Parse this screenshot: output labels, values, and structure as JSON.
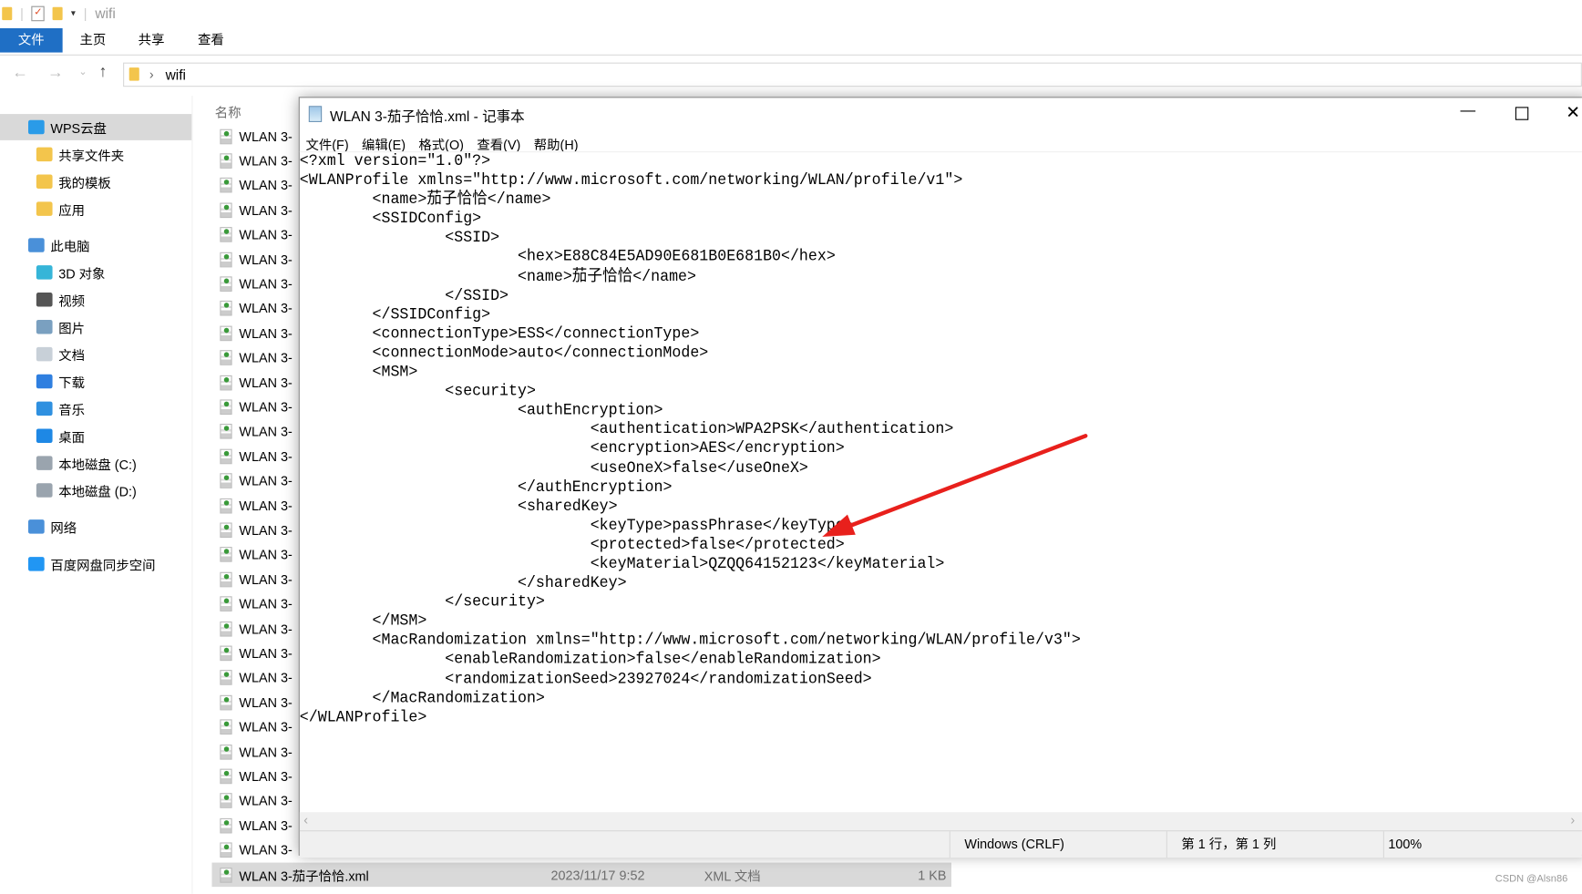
{
  "explorer": {
    "window_title": "wifi",
    "ribbon_tabs": [
      "文件",
      "主页",
      "共享",
      "查看"
    ],
    "address": {
      "path": "wifi"
    },
    "column_header_name": "名称",
    "nav_items": [
      {
        "label": "WPS云盘",
        "icon": "wps-cloud-icon",
        "color": "#2a9be8",
        "selected": true
      },
      {
        "label": "共享文件夹",
        "icon": "shared-folder-icon",
        "color": "#f3c54c"
      },
      {
        "label": "我的模板",
        "icon": "folder-icon",
        "color": "#f3c54c"
      },
      {
        "label": "应用",
        "icon": "apps-folder-icon",
        "color": "#f3c54c"
      },
      {
        "label": "此电脑",
        "icon": "computer-icon",
        "color": "#4a90d9"
      },
      {
        "label": "3D 对象",
        "icon": "3d-objects-icon",
        "color": "#36b5d8"
      },
      {
        "label": "视频",
        "icon": "video-icon",
        "color": "#555555"
      },
      {
        "label": "图片",
        "icon": "pictures-icon",
        "color": "#7aa0c0"
      },
      {
        "label": "文档",
        "icon": "documents-icon",
        "color": "#c8d0d8"
      },
      {
        "label": "下载",
        "icon": "download-icon",
        "color": "#2f7fe0"
      },
      {
        "label": "音乐",
        "icon": "music-icon",
        "color": "#2f90e0"
      },
      {
        "label": "桌面",
        "icon": "desktop-icon",
        "color": "#1e88e5"
      },
      {
        "label": "本地磁盘 (C:)",
        "icon": "drive-c-icon",
        "color": "#9aa4ae"
      },
      {
        "label": "本地磁盘 (D:)",
        "icon": "drive-d-icon",
        "color": "#9aa4ae"
      },
      {
        "label": "网络",
        "icon": "network-icon",
        "color": "#4a90d9"
      },
      {
        "label": "百度网盘同步空间",
        "icon": "baidu-netdisk-icon",
        "color": "#2196f3"
      }
    ],
    "file_rows_partial_label": "WLAN 3-",
    "selected_file": {
      "name": "WLAN 3-茄子恰恰.xml",
      "modified": "2023/11/17 9:52",
      "type": "XML 文档",
      "size": "1 KB"
    }
  },
  "notepad": {
    "title": "WLAN 3-茄子恰恰.xml - 记事本",
    "menu": [
      "文件(F)",
      "编辑(E)",
      "格式(O)",
      "查看(V)",
      "帮助(H)"
    ],
    "content": "<?xml version=\"1.0\"?>\n<WLANProfile xmlns=\"http://www.microsoft.com/networking/WLAN/profile/v1\">\n\t<name>茄子恰恰</name>\n\t<SSIDConfig>\n\t\t<SSID>\n\t\t\t<hex>E88C84E5AD90E681B0E681B0</hex>\n\t\t\t<name>茄子恰恰</name>\n\t\t</SSID>\n\t</SSIDConfig>\n\t<connectionType>ESS</connectionType>\n\t<connectionMode>auto</connectionMode>\n\t<MSM>\n\t\t<security>\n\t\t\t<authEncryption>\n\t\t\t\t<authentication>WPA2PSK</authentication>\n\t\t\t\t<encryption>AES</encryption>\n\t\t\t\t<useOneX>false</useOneX>\n\t\t\t</authEncryption>\n\t\t\t<sharedKey>\n\t\t\t\t<keyType>passPhrase</keyType>\n\t\t\t\t<protected>false</protected>\n\t\t\t\t<keyMaterial>QZQQ64152123</keyMaterial>\n\t\t\t</sharedKey>\n\t\t</security>\n\t</MSM>\n\t<MacRandomization xmlns=\"http://www.microsoft.com/networking/WLAN/profile/v3\">\n\t\t<enableRandomization>false</enableRandomization>\n\t\t<randomizationSeed>23927024</randomizationSeed>\n\t</MacRandomization>\n</WLANProfile>",
    "status": {
      "line_ending": "Windows (CRLF)",
      "position": "第 1 行，第 1 列",
      "zoom": "100%"
    }
  },
  "annotation": {
    "arrow_color": "#e8201c"
  },
  "watermark": "CSDN @Alsn86",
  "colors": {
    "ribbon_file_tab": "#1f6fc5",
    "selection": "#d9d9d9"
  }
}
